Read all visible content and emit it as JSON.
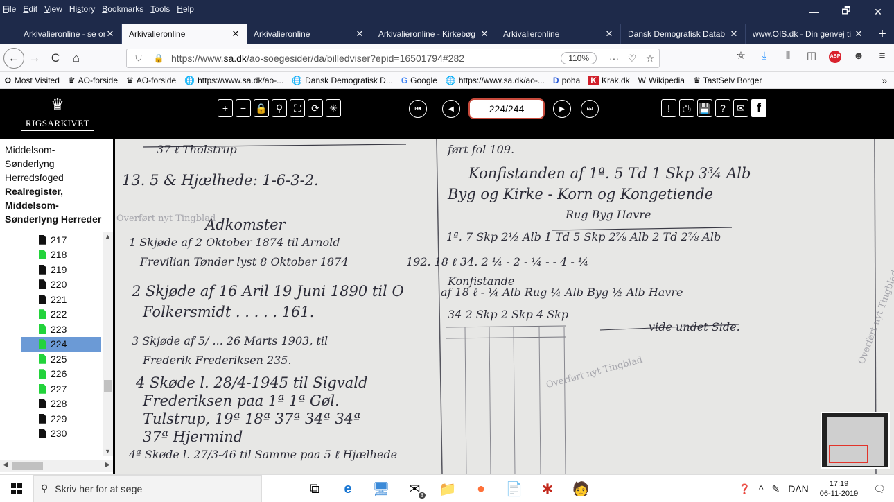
{
  "menu": [
    {
      "pre": "",
      "u": "F",
      "post": "ile"
    },
    {
      "pre": "",
      "u": "E",
      "post": "dit"
    },
    {
      "pre": "",
      "u": "V",
      "post": "iew"
    },
    {
      "pre": "Hi",
      "u": "s",
      "post": "tory"
    },
    {
      "pre": "",
      "u": "B",
      "post": "ookmarks"
    },
    {
      "pre": "",
      "u": "T",
      "post": "ools"
    },
    {
      "pre": "",
      "u": "H",
      "post": "elp"
    }
  ],
  "window_controls": {
    "minimize": "—",
    "restore": "🗗",
    "close": "✕"
  },
  "tabs": [
    {
      "label": "Arkivalieronline - se or",
      "active": false
    },
    {
      "label": "Arkivalieronline",
      "active": true
    },
    {
      "label": "Arkivalieronline",
      "active": false
    },
    {
      "label": "Arkivalieronline - Kirkebøg",
      "active": false
    },
    {
      "label": "Arkivalieronline",
      "active": false
    },
    {
      "label": "Dansk Demografisk Datab",
      "active": false
    },
    {
      "label": "www.OIS.dk - Din genvej ti",
      "active": false
    }
  ],
  "new_tab": "+",
  "tab_close": "✕",
  "nav": {
    "back": "←",
    "forward": "→",
    "reload": "C",
    "home": "⌂",
    "url_prefix": "https://www.",
    "url_domain": "sa.dk",
    "url_rest": "/ao-soegesider/da/billedviser?epid=16501794#282",
    "zoom": "110%",
    "page_actions": "···",
    "pocket": "♡",
    "star": "☆"
  },
  "bookmarks": [
    {
      "icon": "⚙",
      "label": "Most Visited"
    },
    {
      "icon": "♛",
      "label": "AO-forside"
    },
    {
      "icon": "♛",
      "label": "AO-forside"
    },
    {
      "icon": "🌐",
      "label": "https://www.sa.dk/ao-..."
    },
    {
      "icon": "🌐",
      "label": "Dansk Demografisk D..."
    },
    {
      "icon": "G",
      "label": "Google"
    },
    {
      "icon": "🌐",
      "label": "https://www.sa.dk/ao-..."
    },
    {
      "icon": "D",
      "label": "poha"
    },
    {
      "icon": "K",
      "label": "Krak.dk"
    },
    {
      "icon": "W",
      "label": "Wikipedia"
    },
    {
      "icon": "♛",
      "label": "TastSelv Borger"
    }
  ],
  "bookmarks_more": "»",
  "logo": {
    "crown": "♛",
    "name": "RIGSARKIVET"
  },
  "viewer_tools": {
    "zoom_in": "+",
    "zoom_out": "−",
    "lock": "🔒",
    "magnify": "⚲",
    "fit": "⛶",
    "rotate": "⟳",
    "invert": "✳",
    "first": "⏮",
    "prev": "◀",
    "next": "▶",
    "last": "⏭",
    "page_value": "224/244",
    "report": "!",
    "print": "⎙",
    "save": "💾",
    "help": "?",
    "mail": "✉",
    "facebook": "f"
  },
  "sidebar": {
    "header_lines": [
      "Middelsom-",
      "Sønderlyng",
      "Herredsfoged"
    ],
    "header_bold_lines": [
      "Realregister,",
      "Middelsom-",
      "Sønderlyng Herreder"
    ],
    "items": [
      {
        "label": "217",
        "green": false
      },
      {
        "label": "218",
        "green": true
      },
      {
        "label": "219",
        "green": false
      },
      {
        "label": "220",
        "green": false
      },
      {
        "label": "221",
        "green": false
      },
      {
        "label": "222",
        "green": true
      },
      {
        "label": "223",
        "green": true
      },
      {
        "label": "224",
        "green": true
      },
      {
        "label": "225",
        "green": true
      },
      {
        "label": "226",
        "green": true
      },
      {
        "label": "227",
        "green": true
      },
      {
        "label": "228",
        "green": false
      },
      {
        "label": "229",
        "green": false
      },
      {
        "label": "230",
        "green": false
      }
    ],
    "selected_index": 7
  },
  "taskbar": {
    "search_placeholder": "Skriv her for at søge",
    "search_icon": "⚲",
    "mail_badge": "8",
    "language": "DAN",
    "time": "17:19",
    "date": "06-11-2019"
  }
}
